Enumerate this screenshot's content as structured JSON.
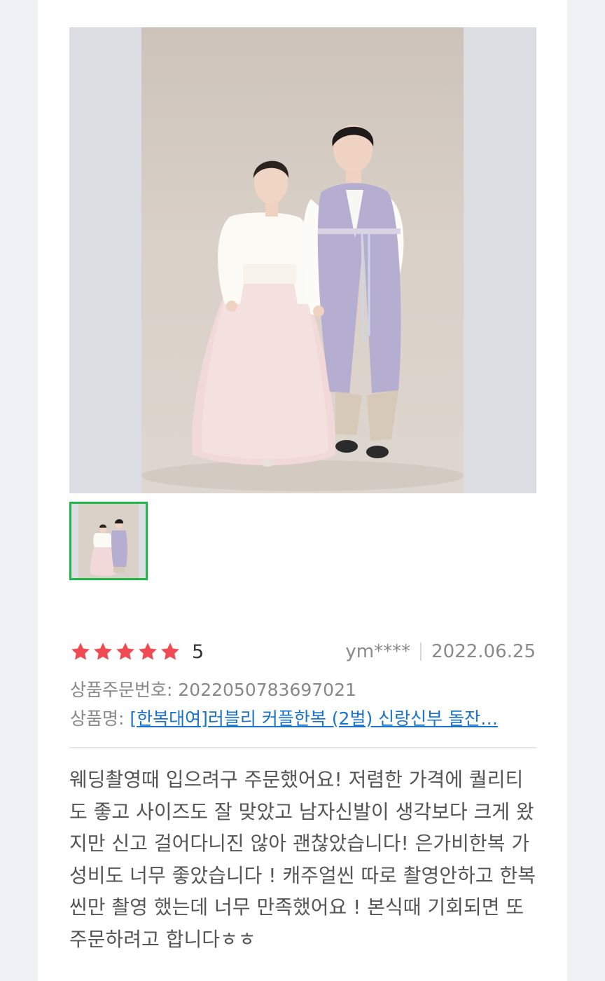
{
  "review": {
    "photo_alt": "커플 한복 사진",
    "rating_icon": "star-icon",
    "star_color": "#f04a55",
    "star_count": 5,
    "score": "5",
    "user": "ym****",
    "date": "2022.06.25",
    "order_label": "상품주문번호:",
    "order_number": "2022050783697021",
    "product_label": "상품명:",
    "product_name": "[한복대여]러블리 커플한복 (2벌) 신랑신부 돌잔…",
    "body": "웨딩촬영때 입으려구 주문했어요! 저렴한 가격에 퀄리티도 좋고 사이즈도 잘 맞았고 남자신발이 생각보다 크게 왔지만 신고 걸어다니진 않아 괜찮았습니다! 은가비한복 가성비도 너무 좋았습니다 ! 캐주얼씬 따로 촬영안하고 한복씬만 촬영 했는데 너무 만족했어요 ! 본식때 기회되면 또 주문하려고 합니다ㅎㅎ"
  },
  "colors": {
    "thumb_selected_border": "#1db847",
    "link": "#1a73c8"
  }
}
